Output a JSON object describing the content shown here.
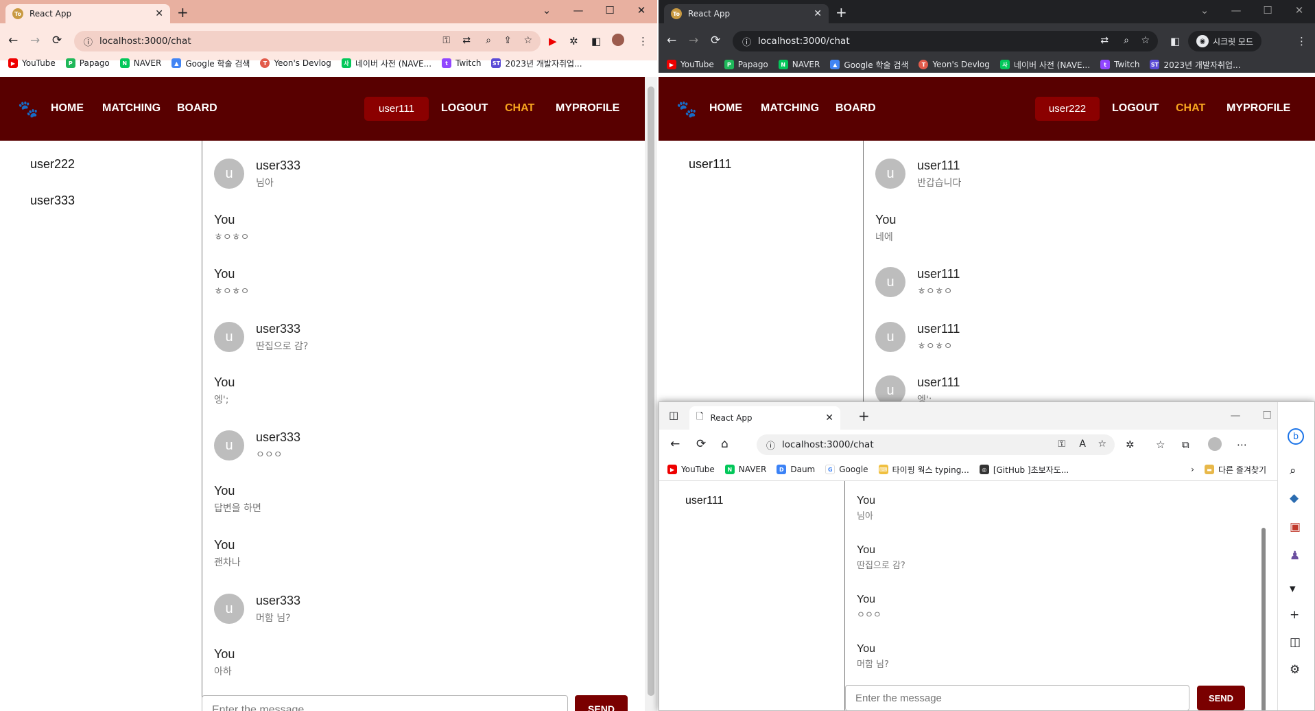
{
  "window1": {
    "tab_title": "React App",
    "address": "localhost:3000/chat",
    "bookmarks": [
      "YouTube",
      "Papago",
      "NAVER",
      "Google 학술 검색",
      "Yeon's Devlog",
      "네이버 사전 (NAVE...",
      "Twitch",
      "2023년 개발자취업..."
    ],
    "nav": {
      "home": "HOME",
      "matching": "MATCHING",
      "board": "BOARD",
      "user": "user111",
      "logout": "LOGOUT",
      "chat": "CHAT",
      "profile": "MYPROFILE"
    },
    "chat_list": [
      "user222",
      "user333"
    ],
    "messages": [
      {
        "name": "user333",
        "text": "님아",
        "avatar": "u"
      },
      {
        "name": "You",
        "text": "ㅎㅇㅎㅇ"
      },
      {
        "name": "You",
        "text": "ㅎㅇㅎㅇ"
      },
      {
        "name": "user333",
        "text": "딴집으로 감?",
        "avatar": "u"
      },
      {
        "name": "You",
        "text": "엥';"
      },
      {
        "name": "user333",
        "text": "ㅇㅇㅇ",
        "avatar": "u"
      },
      {
        "name": "You",
        "text": "답변을 하면"
      },
      {
        "name": "You",
        "text": "괜차나"
      },
      {
        "name": "user333",
        "text": "머함 님?",
        "avatar": "u"
      },
      {
        "name": "You",
        "text": "아하"
      }
    ],
    "input_placeholder": "Enter the message",
    "send": "SEND"
  },
  "window2": {
    "tab_title": "React App",
    "address": "localhost:3000/chat",
    "incognito": "시크릿 모드",
    "bookmarks": [
      "YouTube",
      "Papago",
      "NAVER",
      "Google 학술 검색",
      "Yeon's Devlog",
      "네이버 사전 (NAVE...",
      "Twitch",
      "2023년 개발자취업..."
    ],
    "nav": {
      "home": "HOME",
      "matching": "MATCHING",
      "board": "BOARD",
      "user": "user222",
      "logout": "LOGOUT",
      "chat": "CHAT",
      "profile": "MYPROFILE"
    },
    "chat_list": [
      "user111"
    ],
    "messages": [
      {
        "name": "user111",
        "text": "반갑습니다",
        "avatar": "u"
      },
      {
        "name": "You",
        "text": "네에"
      },
      {
        "name": "user111",
        "text": "ㅎㅇㅎㅇ",
        "avatar": "u"
      },
      {
        "name": "user111",
        "text": "ㅎㅇㅎㅇ",
        "avatar": "u"
      },
      {
        "name": "user111",
        "text": "엥';",
        "avatar": "u"
      }
    ]
  },
  "window3": {
    "tab_title": "React App",
    "address": "localhost:3000/chat",
    "favorites": [
      "YouTube",
      "NAVER",
      "Daum",
      "Google",
      "타이핑 웍스 typing...",
      "[GitHub ]초보자도...",
      "다른 즐겨찾기"
    ],
    "chat_list": [
      "user111"
    ],
    "messages": [
      {
        "name": "You",
        "text": "님아"
      },
      {
        "name": "You",
        "text": "딴집으로 감?"
      },
      {
        "name": "You",
        "text": "ㅇㅇㅇ"
      },
      {
        "name": "You",
        "text": "머함 님?"
      }
    ],
    "input_placeholder": "Enter the message",
    "send": "SEND"
  },
  "colors": {
    "brand": "#580000",
    "pill": "#8b0000",
    "chat_active": "#f7a51f",
    "send": "#7a0000"
  }
}
